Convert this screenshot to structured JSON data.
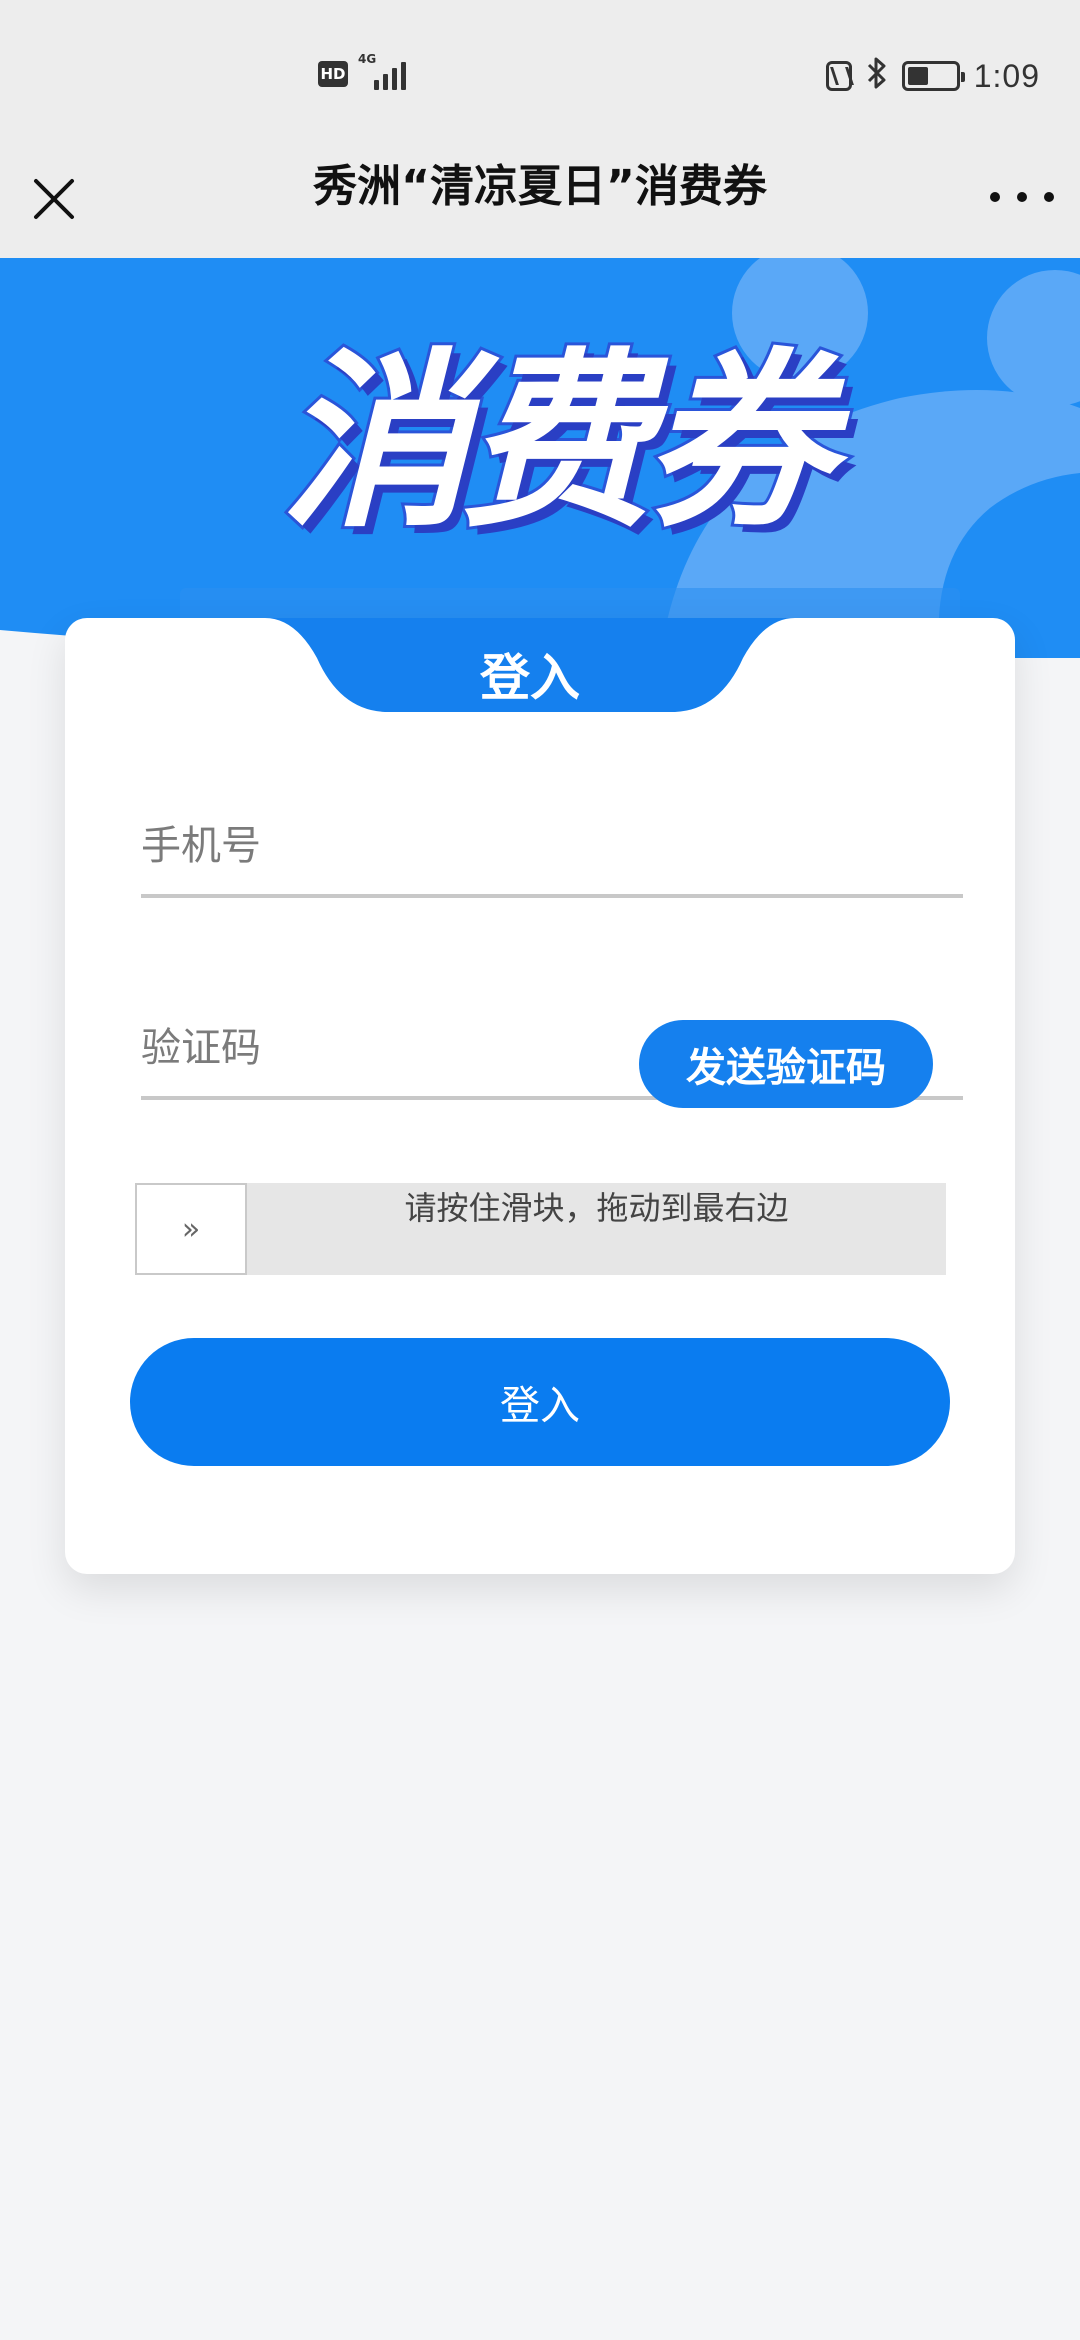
{
  "status_bar": {
    "hd_label": "HD",
    "network_label": "4G",
    "time": "1:09",
    "icons": [
      "nfc-icon",
      "bluetooth-icon",
      "battery-icon"
    ]
  },
  "title_bar": {
    "title": "秀洲“清凉夏日”消费券",
    "close_icon": "close-icon",
    "more_icon": "more-icon"
  },
  "banner": {
    "title": "消费券"
  },
  "login_card": {
    "tab_label": "登入",
    "phone_placeholder": "手机号",
    "code_placeholder": "验证码",
    "send_code_label": "发送验证码",
    "slider_handle_glyph": "»",
    "slider_hint": "请按住滑块，拖动到最右边",
    "submit_label": "登入"
  },
  "colors": {
    "brand_blue": "#1580ee",
    "banner_blue": "#1f8df4",
    "banner_circle": "#5aa8f7",
    "page_bg": "#f4f5f7"
  }
}
